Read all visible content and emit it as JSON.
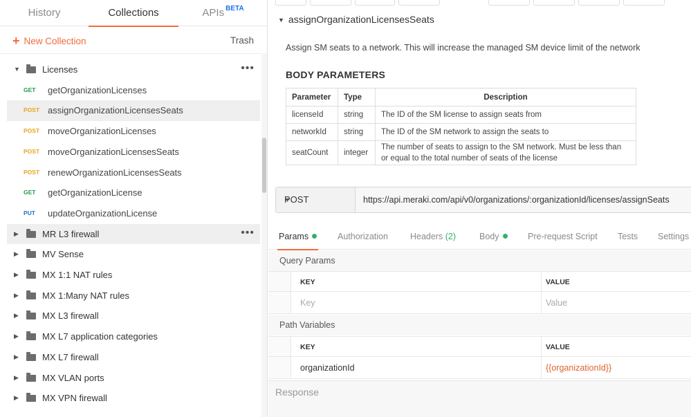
{
  "sidebar": {
    "tabs": [
      {
        "label": "History"
      },
      {
        "label": "Collections"
      },
      {
        "label": "APIs",
        "badge": "BETA"
      }
    ],
    "new_collection_label": "New Collection",
    "trash_label": "Trash",
    "tree": [
      {
        "type": "folder",
        "name": "Licenses",
        "expanded": true
      },
      {
        "type": "request",
        "method": "GET",
        "name": "getOrganizationLicenses"
      },
      {
        "type": "request",
        "method": "POST",
        "name": "assignOrganizationLicensesSeats",
        "selected": true
      },
      {
        "type": "request",
        "method": "POST",
        "name": "moveOrganizationLicenses"
      },
      {
        "type": "request",
        "method": "POST",
        "name": "moveOrganizationLicensesSeats"
      },
      {
        "type": "request",
        "method": "POST",
        "name": "renewOrganizationLicensesSeats"
      },
      {
        "type": "request",
        "method": "GET",
        "name": "getOrganizationLicense"
      },
      {
        "type": "request",
        "method": "PUT",
        "name": "updateOrganizationLicense"
      },
      {
        "type": "folder",
        "name": "MR L3 firewall"
      },
      {
        "type": "folder",
        "name": "MV Sense"
      },
      {
        "type": "folder",
        "name": "MX 1:1 NAT rules"
      },
      {
        "type": "folder",
        "name": "MX 1:Many NAT rules"
      },
      {
        "type": "folder",
        "name": "MX L3 firewall"
      },
      {
        "type": "folder",
        "name": "MX L7 application categories"
      },
      {
        "type": "folder",
        "name": "MX L7 firewall"
      },
      {
        "type": "folder",
        "name": "MX VLAN ports"
      },
      {
        "type": "folder",
        "name": "MX VPN firewall"
      }
    ]
  },
  "doc": {
    "title": "assignOrganizationLicensesSeats",
    "description": "Assign SM seats to a network. This will increase the managed SM device limit of the network",
    "body_heading": "BODY PARAMETERS",
    "table": {
      "headers": [
        "Parameter",
        "Type",
        "Description"
      ],
      "rows": [
        [
          "licenseId",
          "string",
          "The ID of the SM license to assign seats from"
        ],
        [
          "networkId",
          "string",
          "The ID of the SM network to assign the seats to"
        ],
        [
          "seatCount",
          "integer",
          "The number of seats to assign to the SM network. Must be less than or equal to the total number of seats of the license"
        ]
      ]
    }
  },
  "request": {
    "method": "POST",
    "url": "https://api.meraki.com/api/v0/organizations/:organizationId/licenses/assignSeats"
  },
  "req_tabs": {
    "params": "Params",
    "authorization": "Authorization",
    "headers": "Headers",
    "headers_count": "(2)",
    "body": "Body",
    "prerequest": "Pre-request Script",
    "tests": "Tests",
    "settings": "Settings"
  },
  "query_params": {
    "title": "Query Params",
    "key_header": "KEY",
    "value_header": "VALUE",
    "key_placeholder": "Key",
    "value_placeholder": "Value"
  },
  "path_variables": {
    "title": "Path Variables",
    "key_header": "KEY",
    "value_header": "VALUE",
    "rows": [
      {
        "key": "organizationId",
        "value": "{{organizationId}}"
      }
    ]
  },
  "response": {
    "title": "Response"
  },
  "colors": {
    "accent": "#f26b3a",
    "get": "#1f9a4a",
    "post": "#e9a326",
    "put": "#1e73c8",
    "dot": "#2fb36c"
  }
}
